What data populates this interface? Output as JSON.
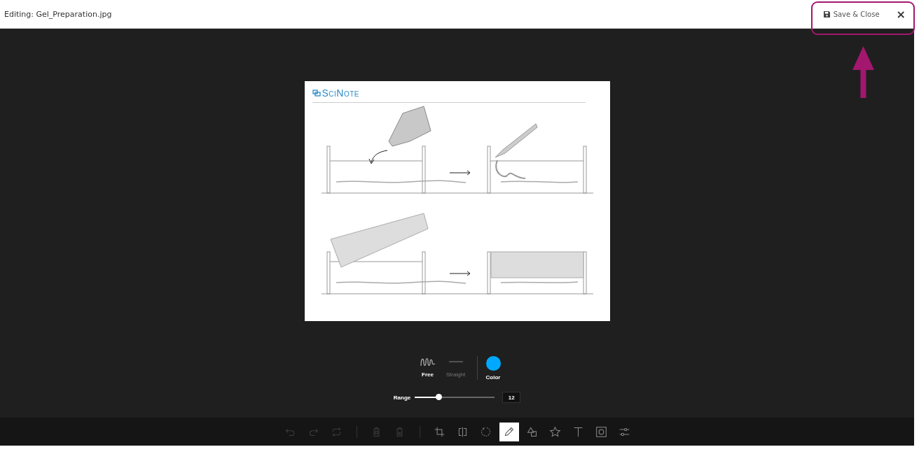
{
  "header": {
    "title": "Editing: Gel_Preparation.jpg",
    "save_button": "Save & Close",
    "close_button": "×"
  },
  "image": {
    "logo": "SciNote"
  },
  "draw_modes": [
    {
      "kind": "free",
      "label": "Free",
      "selected": true
    },
    {
      "kind": "straight",
      "label": "Straight",
      "selected": false
    }
  ],
  "color": {
    "label": "Color",
    "color": "#00a9ff"
  },
  "range": {
    "label": "Range",
    "level": 0.3,
    "value": "12"
  },
  "toolbar": [
    {
      "kind": "undo",
      "disabled": true,
      "selected": false
    },
    {
      "kind": "redo",
      "disabled": true,
      "selected": false
    },
    {
      "kind": "reset",
      "disabled": true,
      "selected": false
    },
    {
      "kind": "separator"
    },
    {
      "kind": "delete",
      "disabled": true,
      "selected": false
    },
    {
      "kind": "delete-all",
      "disabled": true,
      "selected": false
    },
    {
      "kind": "separator"
    },
    {
      "kind": "crop",
      "disabled": false,
      "selected": false
    },
    {
      "kind": "flip",
      "disabled": false,
      "selected": false
    },
    {
      "kind": "rotate",
      "disabled": false,
      "selected": false
    },
    {
      "kind": "draw",
      "disabled": false,
      "selected": true
    },
    {
      "kind": "shape",
      "disabled": false,
      "selected": false
    },
    {
      "kind": "icon",
      "disabled": false,
      "selected": false
    },
    {
      "kind": "text",
      "disabled": false,
      "selected": false
    },
    {
      "kind": "mask",
      "disabled": false,
      "selected": false
    },
    {
      "kind": "filter",
      "disabled": false,
      "selected": false
    }
  ]
}
